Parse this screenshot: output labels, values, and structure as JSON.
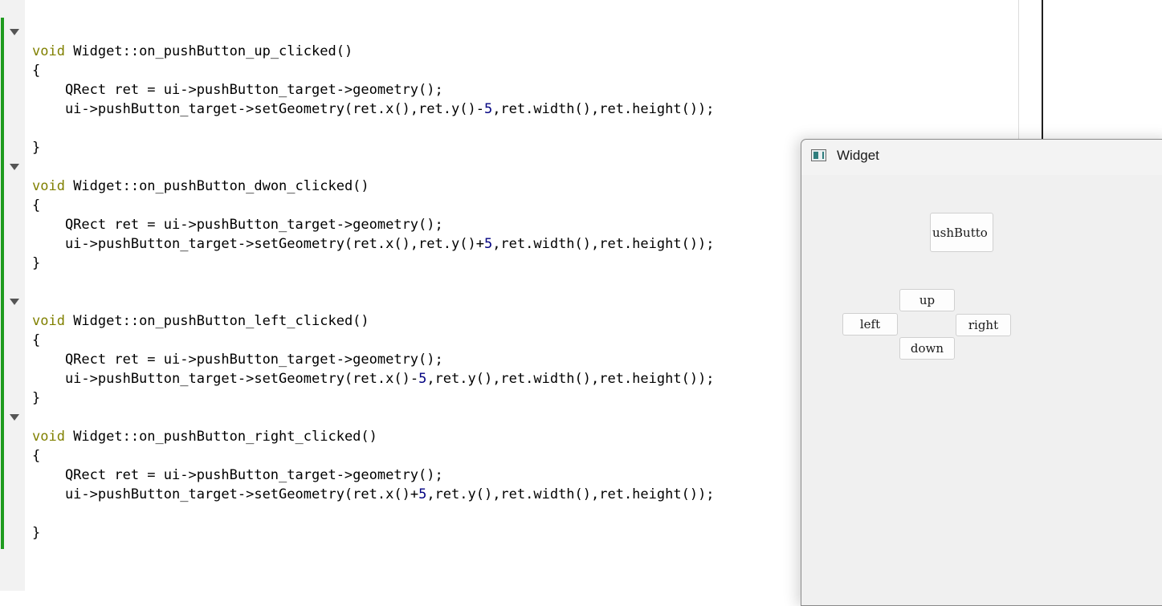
{
  "editor": {
    "lines": [
      "",
      "void Widget::on_pushButton_up_clicked()",
      "{",
      "    QRect ret = ui->pushButton_target->geometry();",
      "    ui->pushButton_target->setGeometry(ret.x(),ret.y()-5,ret.width(),ret.height());",
      "",
      "}",
      "",
      "void Widget::on_pushButton_dwon_clicked()",
      "{",
      "    QRect ret = ui->pushButton_target->geometry();",
      "    ui->pushButton_target->setGeometry(ret.x(),ret.y()+5,ret.width(),ret.height());",
      "}",
      "",
      "",
      "void Widget::on_pushButton_left_clicked()",
      "{",
      "    QRect ret = ui->pushButton_target->geometry();",
      "    ui->pushButton_target->setGeometry(ret.x()-5,ret.y(),ret.width(),ret.height());",
      "}",
      "",
      "void Widget::on_pushButton_right_clicked()",
      "{",
      "    QRect ret = ui->pushButton_target->geometry();",
      "    ui->pushButton_target->setGeometry(ret.x()+5,ret.y(),ret.width(),ret.height());",
      "",
      "}"
    ],
    "keyword_color": "#808000",
    "number_color": "#000080",
    "change_bar_color": "#1f9b1f"
  },
  "widget_window": {
    "title": "Widget",
    "icon": "qt-window-icon",
    "buttons": {
      "target": "ushButto",
      "up": "up",
      "left": "left",
      "right": "right",
      "down": "down"
    }
  }
}
